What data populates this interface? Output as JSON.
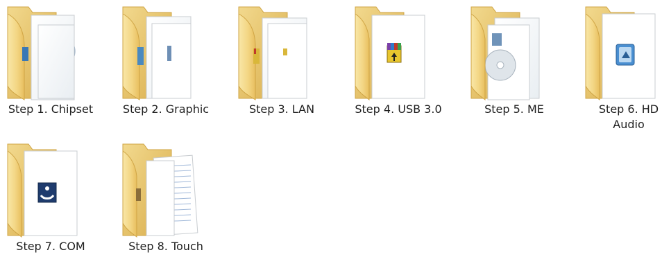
{
  "window": {
    "view": "Large icons"
  },
  "folders": [
    {
      "label": "Step 1. Chipset",
      "contents": [
        "chip-installer-icon",
        "disc-icon"
      ]
    },
    {
      "label": "Step 2. Graphic",
      "contents": [
        "graphics-installer-icon"
      ]
    },
    {
      "label": "Step 3. LAN",
      "contents": [
        "lan-installer-icon"
      ]
    },
    {
      "label": "Step 4. USB 3.0",
      "contents": [
        "winrar-archive-icon"
      ]
    },
    {
      "label": "Step 5. ME",
      "contents": [
        "disc-icon"
      ]
    },
    {
      "label": "Step 6. HD Audio",
      "contents": [
        "audio-setup-icon"
      ]
    },
    {
      "label": "Step 7. COM",
      "contents": [
        "setup-icon"
      ]
    },
    {
      "label": "Step 8. Touch",
      "contents": [
        "text-document-icon"
      ]
    }
  ],
  "colors": {
    "folder_back": "#e9c66a",
    "folder_front": "#f6dd8f",
    "folder_edge": "#d2a843",
    "paper": "#ffffff",
    "label_text": "#1e1e1e"
  }
}
